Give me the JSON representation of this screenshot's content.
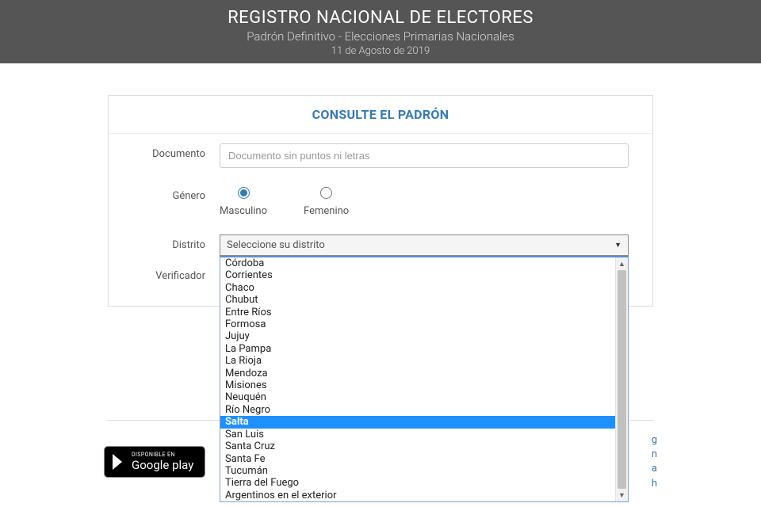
{
  "header": {
    "title": "REGISTRO NACIONAL DE ELECTORES",
    "subtitle": "Padrón Definitivo - Elecciones Primarias Nacionales",
    "date": "11 de Agosto de 2019"
  },
  "card": {
    "title": "CONSULTE EL PADRÓN"
  },
  "form": {
    "documento_label": "Documento",
    "documento_placeholder": "Documento sin puntos ni letras",
    "genero_label": "Género",
    "genero_options": {
      "masculino": "Masculino",
      "femenino": "Femenino"
    },
    "distrito_label": "Distrito",
    "distrito_selected": "Seleccione su distrito",
    "distrito_options": [
      "Córdoba",
      "Corrientes",
      "Chaco",
      "Chubut",
      "Entre Ríos",
      "Formosa",
      "Jujuy",
      "La Pampa",
      "La Rioja",
      "Mendoza",
      "Misiones",
      "Neuquén",
      "Río Negro",
      "Salta",
      "San Luis",
      "Santa Cruz",
      "Santa Fe",
      "Tucumán",
      "Tierra del Fuego",
      "Argentinos en el exterior"
    ],
    "distrito_highlighted_index": 13,
    "verificador_label": "Verificador"
  },
  "footer": {
    "gplay_small": "DISPONIBLE EN",
    "gplay_big": "Google play",
    "right_lines": [
      "g",
      "n",
      "a",
      "h"
    ]
  }
}
